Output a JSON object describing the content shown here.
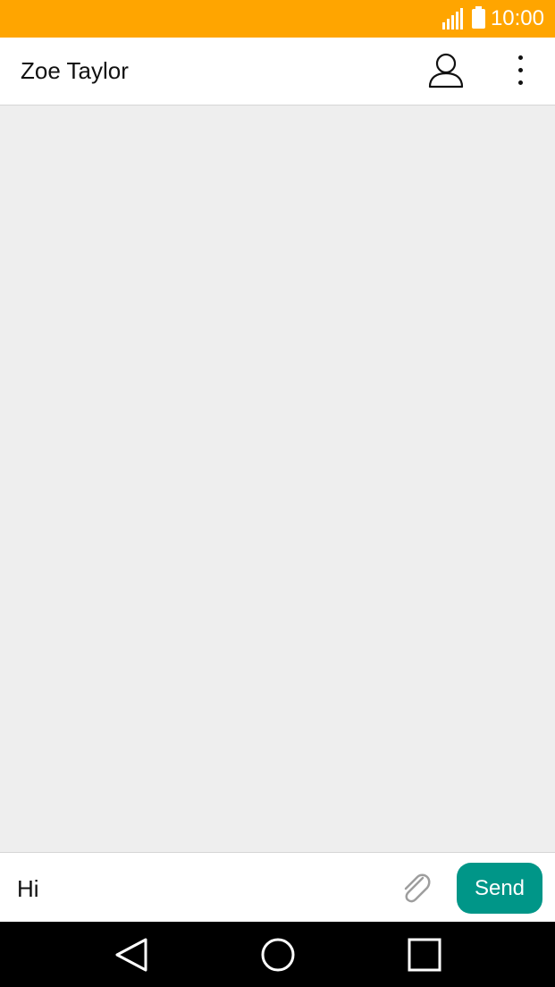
{
  "status_bar": {
    "time": "10:00",
    "background": "#ffa500",
    "icons": [
      "signal-icon",
      "battery-icon"
    ]
  },
  "header": {
    "title": "Zoe Taylor",
    "contact_icon": "person-outline-icon",
    "menu_icon": "more-vertical-icon"
  },
  "conversation": {
    "messages": []
  },
  "composer": {
    "input_value": "Hi",
    "attach_icon": "paperclip-icon",
    "send_label": "Send",
    "send_color": "#009688"
  },
  "nav_bar": {
    "buttons": [
      "back-icon",
      "home-icon",
      "recents-icon"
    ]
  }
}
